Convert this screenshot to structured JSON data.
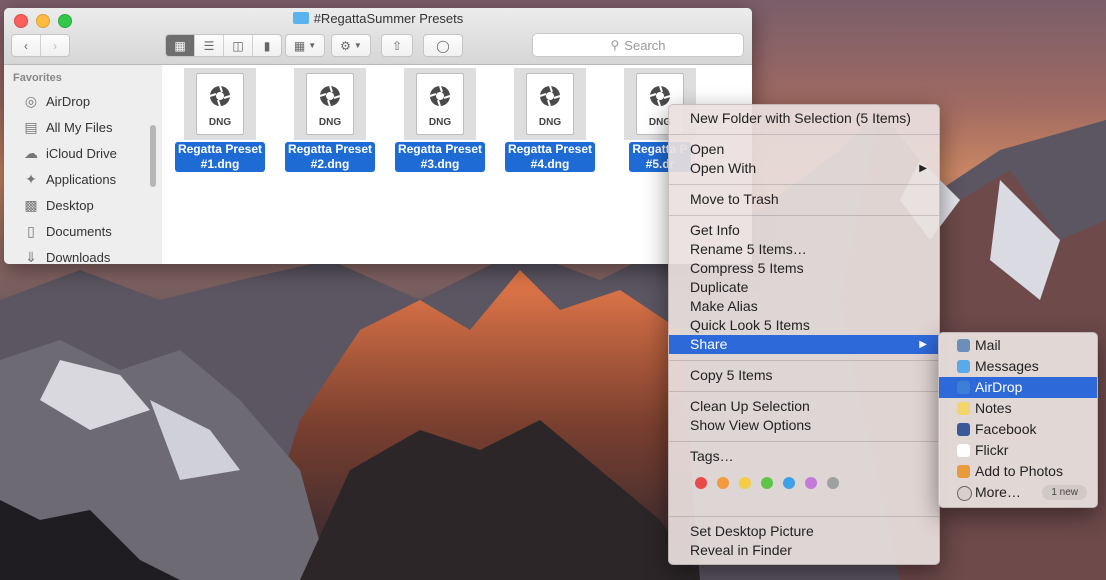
{
  "window": {
    "title": "#RegattaSummer Presets",
    "search_placeholder": "Search"
  },
  "sidebar": {
    "section": "Favorites",
    "items": [
      {
        "label": "AirDrop",
        "icon": "airdrop-icon"
      },
      {
        "label": "All My Files",
        "icon": "all-files-icon"
      },
      {
        "label": "iCloud Drive",
        "icon": "cloud-icon"
      },
      {
        "label": "Applications",
        "icon": "applications-icon"
      },
      {
        "label": "Desktop",
        "icon": "desktop-icon"
      },
      {
        "label": "Documents",
        "icon": "documents-icon"
      },
      {
        "label": "Downloads",
        "icon": "downloads-icon"
      }
    ]
  },
  "files": [
    {
      "line1": "Regatta Preset",
      "line2": "#1.dng",
      "type": "DNG"
    },
    {
      "line1": "Regatta Preset",
      "line2": "#2.dng",
      "type": "DNG"
    },
    {
      "line1": "Regatta Preset",
      "line2": "#3.dng",
      "type": "DNG"
    },
    {
      "line1": "Regatta Preset",
      "line2": "#4.dng",
      "type": "DNG"
    },
    {
      "line1": "Regatta P",
      "line2": "#5.dr",
      "type": "DNG"
    }
  ],
  "context_menu": {
    "new_folder": "New Folder with Selection (5 Items)",
    "open": "Open",
    "open_with": "Open With",
    "move_to_trash": "Move to Trash",
    "get_info": "Get Info",
    "rename": "Rename 5 Items…",
    "compress": "Compress 5 Items",
    "duplicate": "Duplicate",
    "make_alias": "Make Alias",
    "quick_look": "Quick Look 5 Items",
    "share": "Share",
    "copy": "Copy 5 Items",
    "clean_up": "Clean Up Selection",
    "view_options": "Show View Options",
    "tags": "Tags…",
    "tag_colors": [
      "#e84b48",
      "#f19a3e",
      "#f5cc45",
      "#5fc54a",
      "#3ea1ea",
      "#c37ad9",
      "#a0a0a0"
    ],
    "set_desktop": "Set Desktop Picture",
    "reveal": "Reveal in Finder"
  },
  "share_menu": {
    "items": [
      {
        "label": "Mail",
        "color": "#6b8fb8"
      },
      {
        "label": "Messages",
        "color": "#5aa9e8"
      },
      {
        "label": "AirDrop",
        "color": "#3b7fd6"
      },
      {
        "label": "Notes",
        "color": "#f2d56b"
      },
      {
        "label": "Facebook",
        "color": "#3b5998"
      },
      {
        "label": "Flickr",
        "color": "#ffffff"
      },
      {
        "label": "Add to Photos",
        "color": "#e89a3c"
      },
      {
        "label": "More…",
        "color": "#d8cfcd"
      }
    ],
    "more_badge": "1 new",
    "highlighted": "AirDrop"
  },
  "colors": {
    "selection": "#1f6bd6",
    "menu_highlight": "#2e69da"
  }
}
